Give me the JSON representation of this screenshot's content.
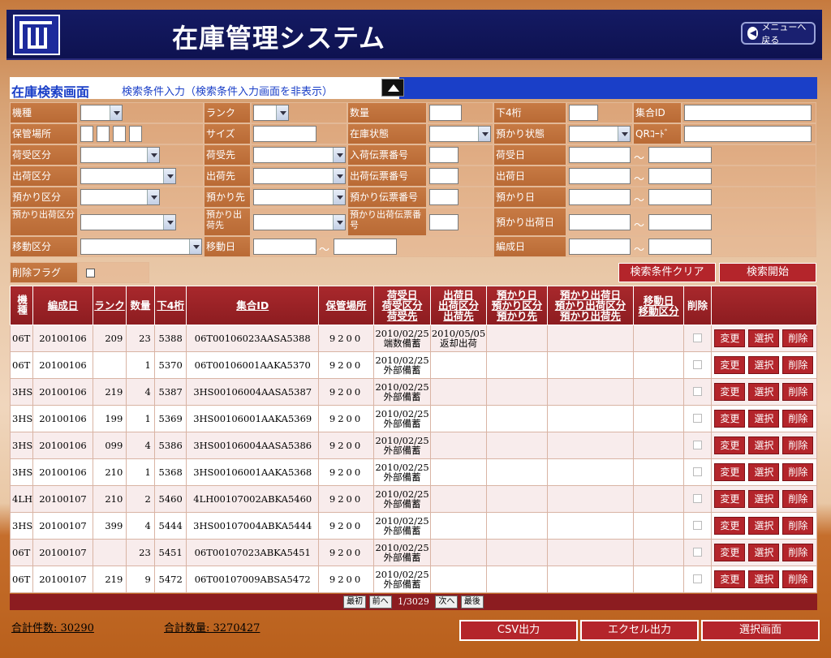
{
  "app": {
    "title": "在庫管理システム",
    "menu_button": "メニューへ戻る"
  },
  "section": {
    "title": "在庫検索画面",
    "subtitle": "検索条件入力（検索条件入力画面を非表示）"
  },
  "form": {
    "labels": {
      "kishu": "機種",
      "rank": "ランク",
      "suryo": "数量",
      "shimo4": "下4桁",
      "shugo_id": "集合ID",
      "hokan": "保管場所",
      "size": "サイズ",
      "zaiko_jotai": "在庫状態",
      "azukari_jotai": "預かり状態",
      "qr": "QRｺｰﾄﾞ",
      "niuke_kubun": "荷受区分",
      "niuke_saki": "荷受先",
      "nyuka_denpyo": "入荷伝票番号",
      "niuke_bi": "荷受日",
      "shukka_kubun": "出荷区分",
      "shukka_saki": "出荷先",
      "shukka_denpyo": "出荷伝票番号",
      "shukka_bi": "出荷日",
      "azukari_kubun": "預かり区分",
      "azukari_saki": "預かり先",
      "azukari_denpyo": "預かり伝票番号",
      "azukari_bi": "預かり日",
      "azukari_shukka_kubun": "預かり出荷区分",
      "azukari_shukka_saki": "預かり出荷先",
      "azukari_shukka_denpyo": "預かり出荷伝票番号",
      "azukari_shukka_bi": "預かり出荷日",
      "ido_kubun": "移動区分",
      "ido_bi": "移動日",
      "hensei_bi": "編成日",
      "sakujo_flag": "削除フラグ"
    },
    "tilde": "～",
    "clear_button": "検索条件クリア",
    "search_button": "検索開始"
  },
  "table": {
    "headers": {
      "kishu": "機種",
      "hensei": "編成日",
      "rank": "ランク",
      "suryo": "数量",
      "shimo4": "下4桁",
      "shugo": "集合ID",
      "hokan": "保管場所",
      "niuke1": "荷受日",
      "niuke2": "荷受区分",
      "niuke3": "荷受先",
      "shukka1": "出荷日",
      "shukka2": "出荷区分",
      "shukka3": "出荷先",
      "azukari1": "預かり日",
      "azukari2": "預かり区分",
      "azukari3": "預かり先",
      "azs1": "預かり出荷日",
      "azs2": "預かり出荷区分",
      "azs3": "預かり出荷先",
      "ido1": "移動日",
      "ido2": "移動区分",
      "sakujo": "削除"
    },
    "buttons": {
      "edit": "変更",
      "select": "選択",
      "delete": "削除"
    },
    "rows": [
      {
        "kishu": "06T",
        "hensei": "20100106",
        "rank": "209",
        "suryo": "23",
        "shimo4": "5388",
        "shugo": "06T00106023AASA5388",
        "hokan": "9200",
        "niuke_bi": "2010/02/25",
        "niuke_text": "端数備蓄",
        "shukka_bi": "2010/05/05",
        "shukka_text": "返却出荷"
      },
      {
        "kishu": "06T",
        "hensei": "20100106",
        "rank": "",
        "suryo": "1",
        "shimo4": "5370",
        "shugo": "06T00106001AAKA5370",
        "hokan": "9200",
        "niuke_bi": "2010/02/25",
        "niuke_text": "外部備蓄",
        "shukka_bi": "",
        "shukka_text": ""
      },
      {
        "kishu": "3HS",
        "hensei": "20100106",
        "rank": "219",
        "suryo": "4",
        "shimo4": "5387",
        "shugo": "3HS00106004AASA5387",
        "hokan": "9200",
        "niuke_bi": "2010/02/25",
        "niuke_text": "外部備蓄",
        "shukka_bi": "",
        "shukka_text": ""
      },
      {
        "kishu": "3HS",
        "hensei": "20100106",
        "rank": "199",
        "suryo": "1",
        "shimo4": "5369",
        "shugo": "3HS00106001AAKA5369",
        "hokan": "9200",
        "niuke_bi": "2010/02/25",
        "niuke_text": "外部備蓄",
        "shukka_bi": "",
        "shukka_text": ""
      },
      {
        "kishu": "3HS",
        "hensei": "20100106",
        "rank": "099",
        "suryo": "4",
        "shimo4": "5386",
        "shugo": "3HS00106004AASA5386",
        "hokan": "9200",
        "niuke_bi": "2010/02/25",
        "niuke_text": "外部備蓄",
        "shukka_bi": "",
        "shukka_text": ""
      },
      {
        "kishu": "3HS",
        "hensei": "20100106",
        "rank": "210",
        "suryo": "1",
        "shimo4": "5368",
        "shugo": "3HS00106001AAKA5368",
        "hokan": "9200",
        "niuke_bi": "2010/02/25",
        "niuke_text": "外部備蓄",
        "shukka_bi": "",
        "shukka_text": ""
      },
      {
        "kishu": "4LH",
        "hensei": "20100107",
        "rank": "210",
        "suryo": "2",
        "shimo4": "5460",
        "shugo": "4LH00107002ABKA5460",
        "hokan": "9200",
        "niuke_bi": "2010/02/25",
        "niuke_text": "外部備蓄",
        "shukka_bi": "",
        "shukka_text": ""
      },
      {
        "kishu": "3HS",
        "hensei": "20100107",
        "rank": "399",
        "suryo": "4",
        "shimo4": "5444",
        "shugo": "3HS00107004ABKA5444",
        "hokan": "9200",
        "niuke_bi": "2010/02/25",
        "niuke_text": "外部備蓄",
        "shukka_bi": "",
        "shukka_text": ""
      },
      {
        "kishu": "06T",
        "hensei": "20100107",
        "rank": "",
        "suryo": "23",
        "shimo4": "5451",
        "shugo": "06T00107023ABKA5451",
        "hokan": "9200",
        "niuke_bi": "2010/02/25",
        "niuke_text": "外部備蓄",
        "shukka_bi": "",
        "shukka_text": ""
      },
      {
        "kishu": "06T",
        "hensei": "20100107",
        "rank": "219",
        "suryo": "9",
        "shimo4": "5472",
        "shugo": "06T00107009ABSA5472",
        "hokan": "9200",
        "niuke_bi": "2010/02/25",
        "niuke_text": "外部備蓄",
        "shukka_bi": "",
        "shukka_text": ""
      }
    ]
  },
  "pager": {
    "first": "最初",
    "prev": "前へ",
    "position": "1/3029",
    "next": "次へ",
    "last": "最後"
  },
  "totals": {
    "count": "合計件数: 30290",
    "quantity": "合計数量: 3270427"
  },
  "actions": {
    "csv": "CSV出力",
    "excel": "エクセル出力",
    "select_screen": "選択画面"
  }
}
